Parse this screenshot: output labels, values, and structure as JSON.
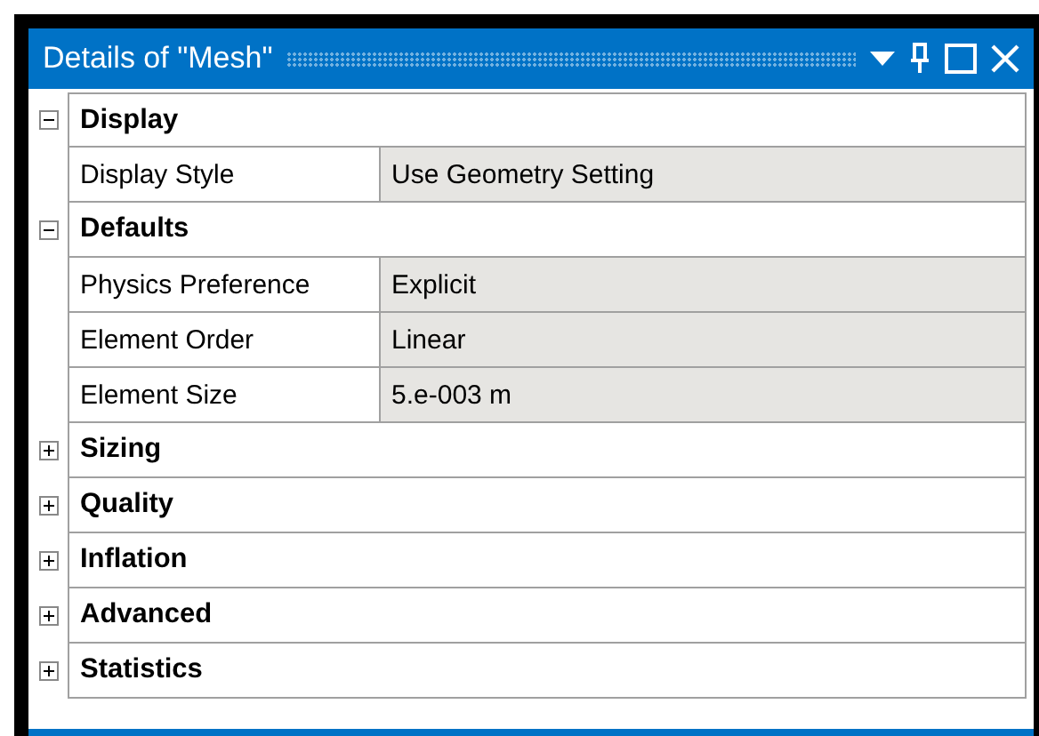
{
  "window": {
    "title": "Details of \"Mesh\""
  },
  "sections": [
    {
      "label": "Display",
      "expanded": true,
      "rows": [
        {
          "name": "Display Style",
          "value": "Use Geometry Setting"
        }
      ]
    },
    {
      "label": "Defaults",
      "expanded": true,
      "rows": [
        {
          "name": "Physics Preference",
          "value": "Explicit"
        },
        {
          "name": "Element Order",
          "value": "Linear"
        },
        {
          "name": "Element Size",
          "value": "5.e-003 m"
        }
      ]
    },
    {
      "label": "Sizing",
      "expanded": false
    },
    {
      "label": "Quality",
      "expanded": false
    },
    {
      "label": "Inflation",
      "expanded": false
    },
    {
      "label": "Advanced",
      "expanded": false
    },
    {
      "label": "Statistics",
      "expanded": false
    }
  ]
}
